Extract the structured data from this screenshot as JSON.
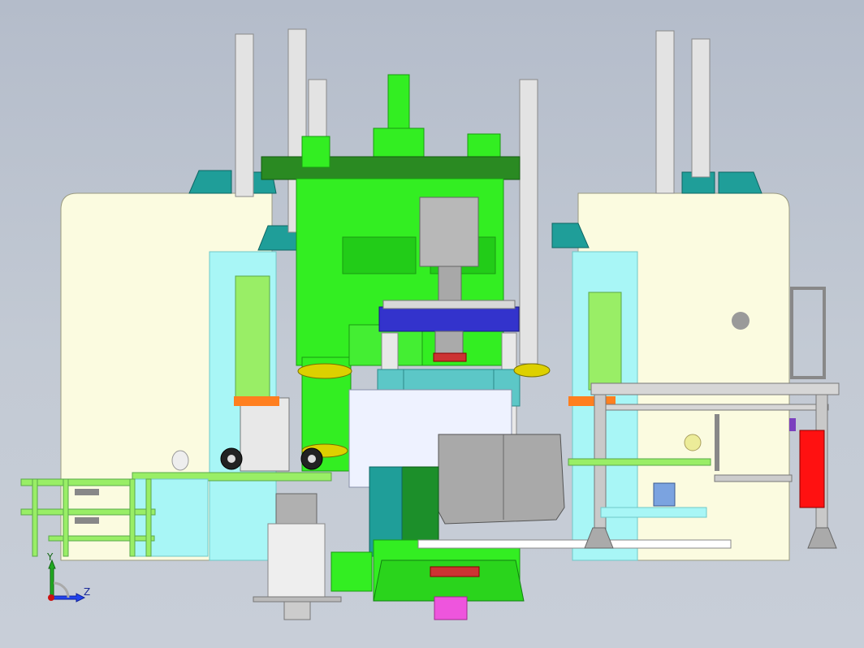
{
  "viewport": {
    "colors": {
      "background": "#bfc6d0",
      "housing": "#fbfbe0",
      "press_green": "#33ee22",
      "steel": "#c9c9c9",
      "teal": "#1f9e99",
      "cyan": "#99ffff",
      "orange": "#ff7f1f",
      "blue": "#3333cc",
      "magenta": "#ee55dd",
      "red": "#ff1111"
    }
  },
  "triad": {
    "y_label": "Y",
    "z_label": "Z",
    "icon": "coordinate-triad-icon"
  }
}
